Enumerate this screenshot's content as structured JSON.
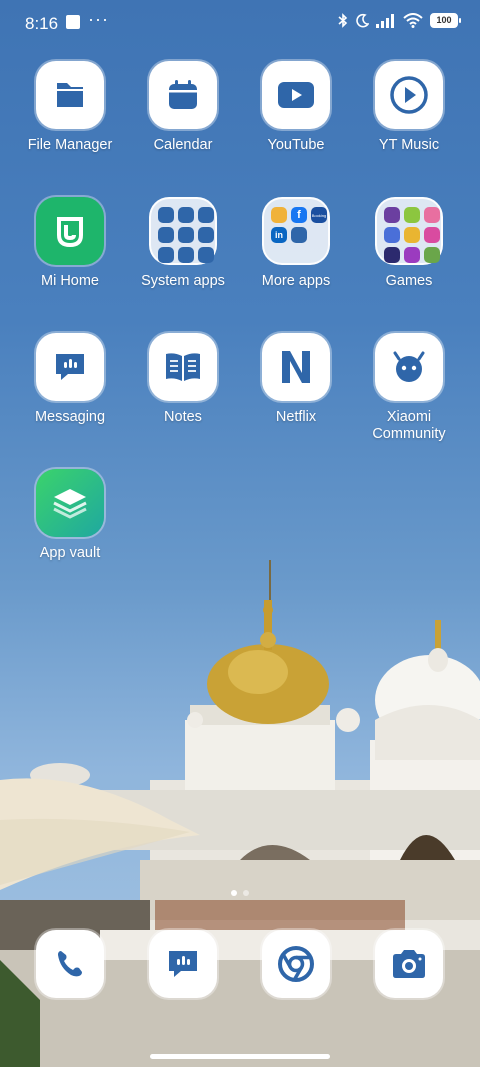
{
  "status_bar": {
    "time": "8:16",
    "dots": "···",
    "battery": "100"
  },
  "apps": [
    {
      "label": "File Manager",
      "icon": "folder-icon"
    },
    {
      "label": "Calendar",
      "icon": "calendar-icon"
    },
    {
      "label": "YouTube",
      "icon": "play-icon"
    },
    {
      "label": "YT Music",
      "icon": "music-play-icon"
    },
    {
      "label": "Mi Home",
      "icon": "mi-home-icon"
    },
    {
      "label": "System apps",
      "icon": "folder-grid"
    },
    {
      "label": "More apps",
      "icon": "folder-grid"
    },
    {
      "label": "Games",
      "icon": "folder-grid"
    },
    {
      "label": "Messaging",
      "icon": "message-icon"
    },
    {
      "label": "Notes",
      "icon": "book-icon"
    },
    {
      "label": "Netflix",
      "icon": "netflix-n-icon"
    },
    {
      "label": "Xiaomi Community",
      "icon": "community-icon"
    },
    {
      "label": "App vault",
      "icon": "layers-icon"
    }
  ],
  "more_apps_badge": "Booking",
  "dock": [
    {
      "name": "phone",
      "icon": "phone-icon"
    },
    {
      "name": "messaging",
      "icon": "message-icon"
    },
    {
      "name": "chrome",
      "icon": "chrome-icon"
    },
    {
      "name": "camera",
      "icon": "camera-icon"
    }
  ],
  "pages": {
    "count": 2,
    "active": 1
  },
  "colors": {
    "icon_blue": "#2f66a9",
    "mi_home_green": "#1eb56b",
    "app_vault_green": "#22c55e"
  }
}
